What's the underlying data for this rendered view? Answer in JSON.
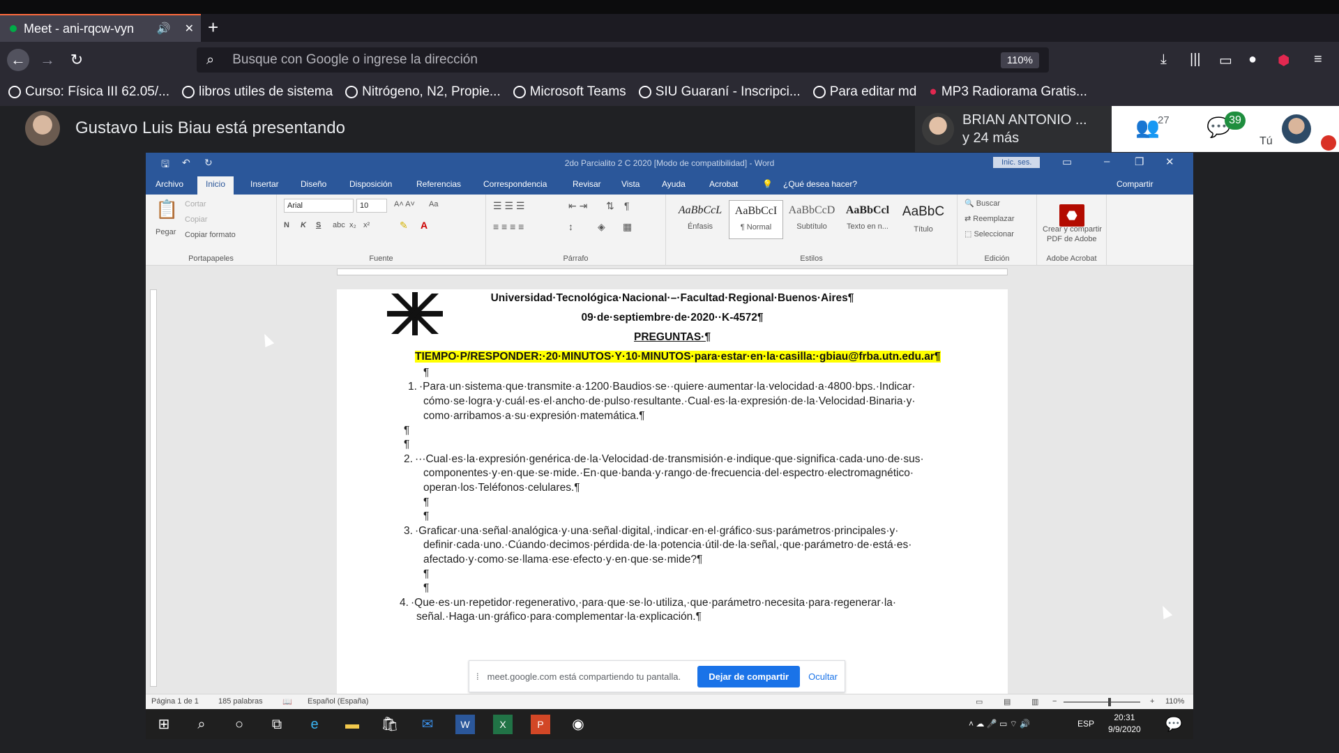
{
  "browser": {
    "tab_title": "Meet - ani-rqcw-vyn",
    "tab_audio_icon": "speaker-icon",
    "new_tab_label": "+",
    "url_placeholder": "Busque con Google o ingrese la dirección",
    "zoom": "110%",
    "bookmarks": [
      "Curso: Física III 62.05/...",
      "libros utiles de sistema",
      "Nitrógeno, N2, Propie...",
      "Microsoft Teams",
      "SIU Guaraní - Inscripci...",
      "Para editar md",
      "MP3 Radiorama Gratis..."
    ]
  },
  "meet": {
    "presenting": "Gustavo Luis Biau está presentando",
    "participant_name": "BRIAN ANTONIO ...",
    "participant_more": "y 24 más",
    "people_count": "27",
    "chat_count": "39",
    "self_label": "Tú"
  },
  "word": {
    "doc_title": "2do Parcialito 2 C 2020 [Modo de compatibilidad] - Word",
    "signin": "Inic. ses.",
    "tabs": [
      "Archivo",
      "Inicio",
      "Insertar",
      "Diseño",
      "Disposición",
      "Referencias",
      "Correspondencia",
      "Revisar",
      "Vista",
      "Ayuda",
      "Acrobat"
    ],
    "tell_me": "¿Qué desea hacer?",
    "share": "Compartir",
    "clipboard": {
      "paste": "Pegar",
      "cut": "Cortar",
      "copy": "Copiar",
      "format": "Copiar formato",
      "label": "Portapapeles"
    },
    "font": {
      "name": "Arial",
      "size": "10",
      "label": "Fuente"
    },
    "paragraph_label": "Párrafo",
    "styles": [
      {
        "preview": "AaBbCcL",
        "name": "Énfasis"
      },
      {
        "preview": "AaBbCcI",
        "name": "¶ Normal"
      },
      {
        "preview": "AaBbCcD",
        "name": "Subtítulo"
      },
      {
        "preview": "AaBbCcl",
        "name": "Texto en n..."
      },
      {
        "preview": "AaBbC",
        "name": "Título"
      }
    ],
    "styles_label": "Estilos",
    "editing": {
      "find": "Buscar",
      "replace": "Reemplazar",
      "select": "Seleccionar",
      "label": "Edición"
    },
    "acrobat": {
      "line1": "Crear y compartir",
      "line2": "PDF de Adobe",
      "label": "Adobe Acrobat"
    },
    "document": {
      "line1": "Universidad·Tecnológica·Nacional·–·Facultad·Regional·Buenos·Aires¶",
      "line2": "09·de·septiembre·de·2020··K-4572¶",
      "line3": "PREGUNTAS·¶",
      "line4": "TIEMPO·P/RESPONDER:·20·MINUTOS·Y·10·MINUTOS·para·estar·en·la·casilla:·gbiau@frba.utn.edu.ar¶",
      "q1_num": "1.",
      "q1": [
        "·Para·un·sistema·que·transmite·a·1200·Baudios·se··quiere·aumentar·la·velocidad·a·4800·bps.·Indicar·",
        "cómo·se·logra·y·cuál·es·el·ancho·de·pulso·resultante.·Cual·es·la·expresión·de·la·Velocidad·Binaria·y·",
        "como·arribamos·a·su·expresión·matemática.¶"
      ],
      "q2_num": "2.",
      "q2": [
        "···Cual·es·la·expresión·genérica·de·la·Velocidad·de·transmisión·e·indique·que·significa·cada·uno·de·sus·",
        "componentes·y·en·que·se·mide.·En·que·banda·y·rango·de·frecuencia·del·espectro·electromagnético·",
        "operan·los·Teléfonos·celulares.¶"
      ],
      "q3_num": "3.",
      "q3": [
        "·Graficar·una·señal·analógica·y·una·señal·digital,·indicar·en·el·gráfico·sus·parámetros·principales·y·",
        "definir·cada·uno.·Cúando·decimos·pérdida·de·la·potencia·útil·de·la·señal,·que·parámetro·de·está·es·",
        "afectado·y·como·se·llama·ese·efecto·y·en·que·se·mide?¶"
      ],
      "q4_num": "4.",
      "q4": [
        "·Que·es·un·repetidor·regenerativo,·para·que·se·lo·utiliza,·que·parámetro·necesita·para·regenerar·la·",
        "señal.·Haga·un·gráfico·para·complementar·la·explicación.¶"
      ],
      "pilcrow": "¶"
    },
    "share_bar": {
      "text": "meet.google.com está compartiendo tu pantalla.",
      "stop": "Dejar de compartir",
      "hide": "Ocultar"
    },
    "status": {
      "page": "Página 1 de 1",
      "words": "185 palabras",
      "lang": "Español (España)",
      "zoom": "110%"
    },
    "taskbar": {
      "lang": "ESP",
      "time": "20:31",
      "date": "9/9/2020"
    }
  }
}
